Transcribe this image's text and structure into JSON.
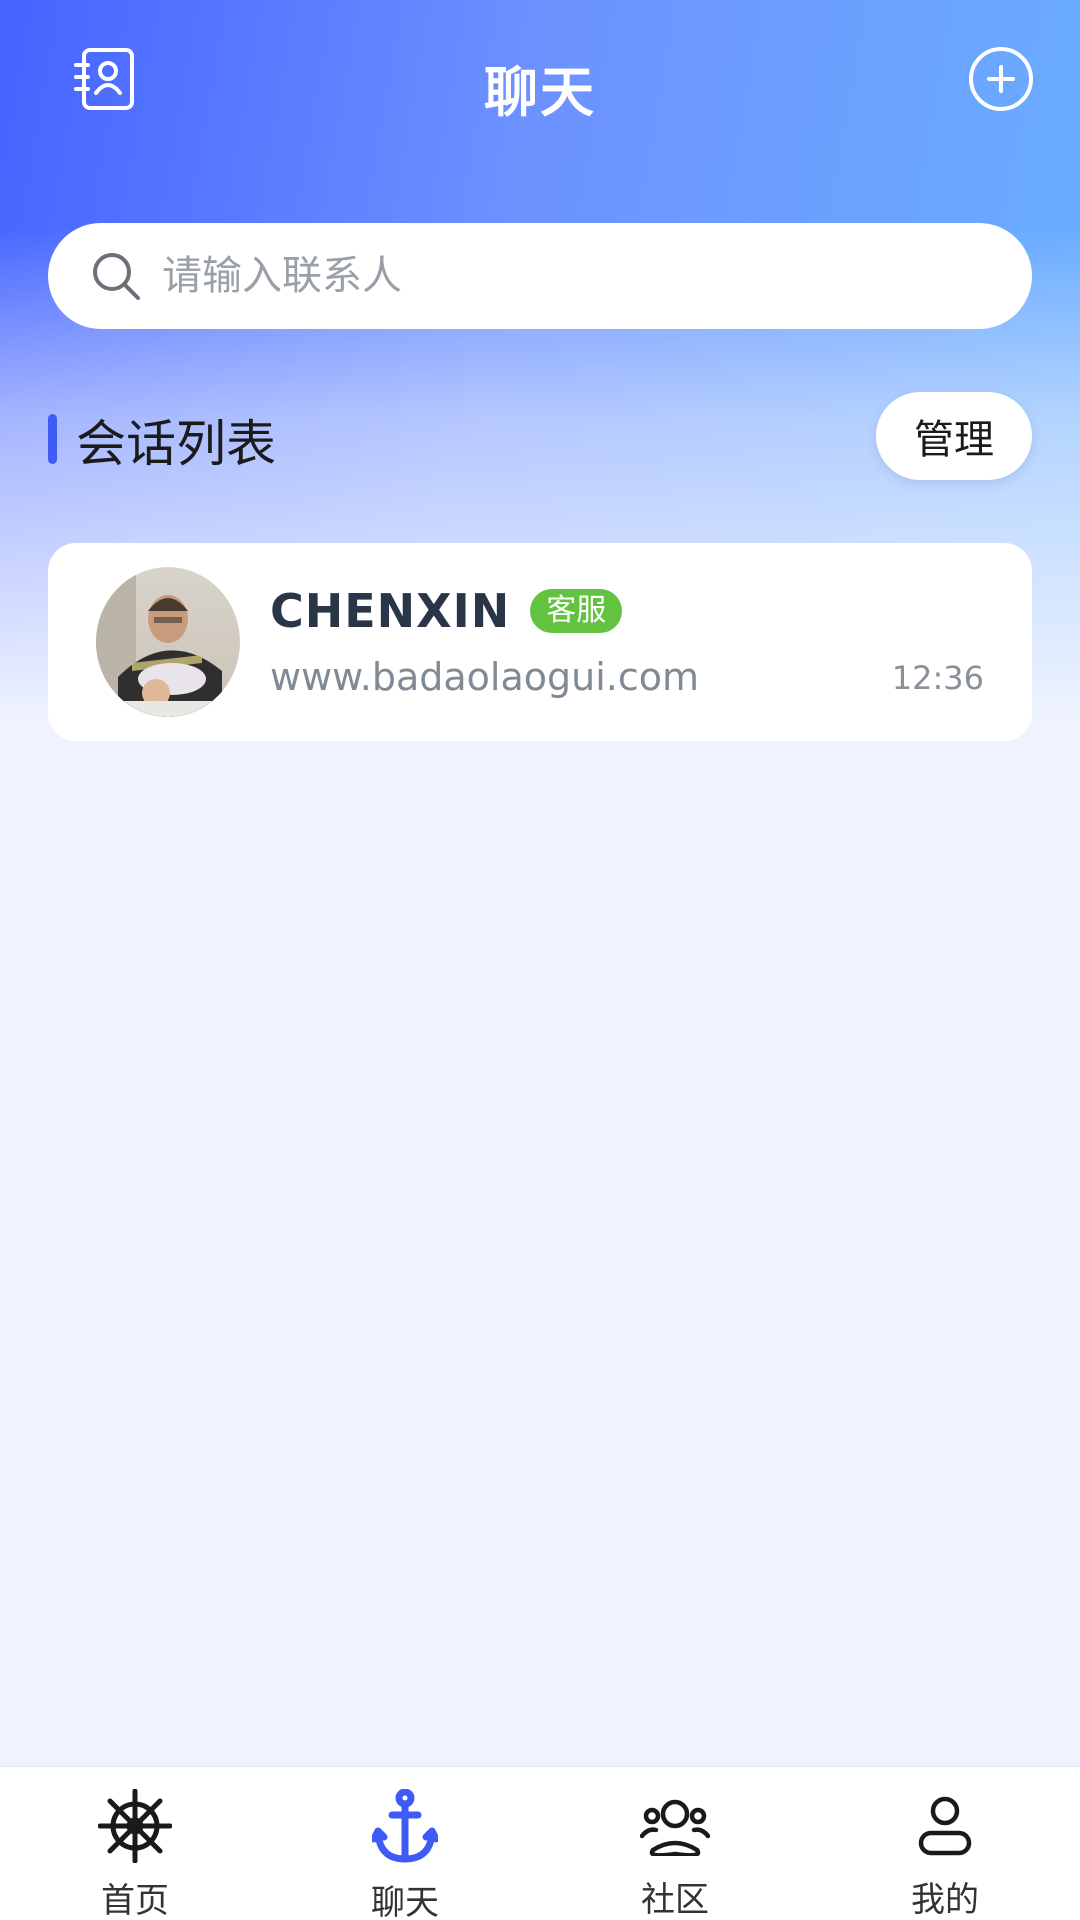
{
  "header": {
    "title": "聊天",
    "contacts_icon": "contacts-book-icon",
    "add_icon": "plus-circle-icon"
  },
  "search": {
    "placeholder": "请输入联系人",
    "value": ""
  },
  "section": {
    "title": "会话列表",
    "manage_label": "管理"
  },
  "conversations": [
    {
      "name": "CHENXIN",
      "badge": "客服",
      "preview": "www.badaolaogui.com",
      "time": "12:36"
    }
  ],
  "tabs": [
    {
      "label": "首页",
      "icon": "ship-wheel-icon",
      "active": false
    },
    {
      "label": "聊天",
      "icon": "anchor-icon",
      "active": true
    },
    {
      "label": "社区",
      "icon": "community-icon",
      "active": false
    },
    {
      "label": "我的",
      "icon": "user-icon",
      "active": false
    }
  ],
  "colors": {
    "accent": "#3f5bf6",
    "badge_green": "#63c23f",
    "page_bg": "#eff3ff"
  }
}
